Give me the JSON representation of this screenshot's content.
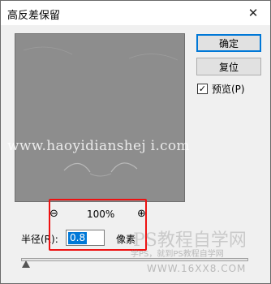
{
  "window": {
    "title": "高反差保留",
    "close_glyph": "✕"
  },
  "buttons": {
    "ok": "确定",
    "reset": "复位"
  },
  "preview_toggle": {
    "label": "预览(P)",
    "checked": true,
    "check_glyph": "✓"
  },
  "zoom": {
    "out_glyph": "⊖",
    "percent": "100%",
    "in_glyph": "⊕"
  },
  "radius": {
    "label": "半径(R):",
    "value": "0.8",
    "unit": "像素"
  },
  "slider": {
    "level_fraction": 0.0
  },
  "overlays": {
    "watermark": "www.haoyidianshej i.com",
    "brand": "PS教程自学网",
    "brand_sub": "学PS，就到PS教程自学网",
    "brand_url": "WWW.16XX8.COM"
  },
  "colors": {
    "highlight": "#ee1111",
    "selection": "#0078d7",
    "preview_gray": "#8d8d8d"
  }
}
